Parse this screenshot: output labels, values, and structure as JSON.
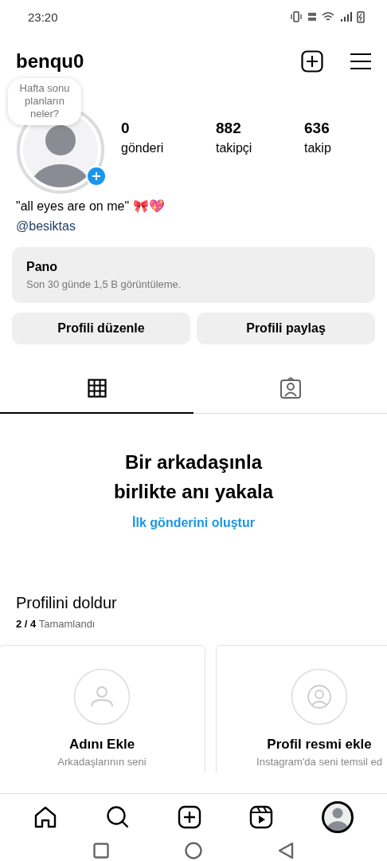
{
  "status_bar": {
    "time": "23:20"
  },
  "header": {
    "username": "benqu0"
  },
  "profile": {
    "note": "Hafta sonu planların neler?",
    "stats": [
      {
        "value": "0",
        "label": "gönderi"
      },
      {
        "value": "882",
        "label": "takipçi"
      },
      {
        "value": "636",
        "label": "takip"
      }
    ],
    "bio": "\"all eyes are on me\" 🎀💖",
    "link": "@besiktas"
  },
  "dashboard": {
    "title": "Pano",
    "subtitle": "Son 30 günde 1,5 B görüntüleme."
  },
  "buttons": [
    "Profili düzenle",
    "Profili paylaş"
  ],
  "tabs": [
    {
      "kind": "grid",
      "selected": true
    },
    {
      "kind": "tagged",
      "selected": false
    }
  ],
  "empty_state": {
    "title": "Bir arkadaşınla birlikte anı yakala",
    "action": "İlk gönderini oluştur"
  },
  "complete_profile": {
    "title": "Profilini doldur",
    "progress": "**2 / 4** Tamamlandı",
    "cards": [
      {
        "kind": "name",
        "title": "Adını Ekle",
        "text": "Arkadaşlarının seni"
      },
      {
        "kind": "photo",
        "title": "Profil resmi ekle",
        "text": "Instagram'da seni temsil ed"
      }
    ]
  },
  "bottom_nav": [
    {
      "kind": "home",
      "selected": false
    },
    {
      "kind": "search",
      "selected": false
    },
    {
      "kind": "create",
      "selected": false
    },
    {
      "kind": "reels",
      "selected": false
    },
    {
      "kind": "profile",
      "selected": true
    }
  ]
}
